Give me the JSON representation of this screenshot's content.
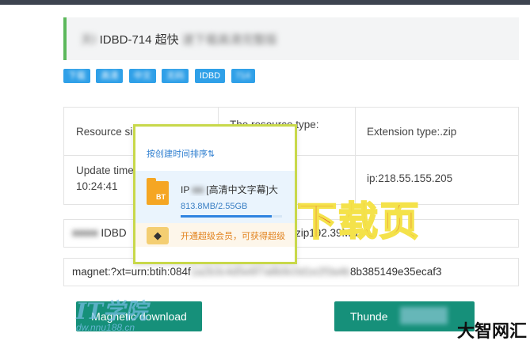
{
  "title": {
    "prefix_blurred": "天Ⅰ",
    "main": "IDBD-714 超快",
    "suffix_blurred": "速下载高清完整版"
  },
  "tags": [
    "下载",
    "高清",
    "中文",
    "无码",
    "IDBD",
    "714"
  ],
  "info": {
    "resource_size_label": "Resource si",
    "resource_type_label": "The resource type:",
    "extension_label": "Extension type:.zip",
    "update_time_label": "Update time",
    "update_time_value": "10:24:41",
    "ip_label": "ip:218.55.155.205"
  },
  "file_row_text": "IDBD",
  "ip_row_text": "zip192.39MB",
  "magnet": {
    "prefix": "magnet:?xt=urn:btih:084f",
    "blurred": "1a2b3c4d5e6f7a8b9c0d1e2f3a4b",
    "suffix": "8b385149e35ecaf3"
  },
  "buttons": {
    "magnetic_download": "Magnetic download",
    "thunder_download": "Thunde"
  },
  "overlay_label": "下载页",
  "popup": {
    "sort_label": "按创建时间排序⇅",
    "file_icon_text": "BT",
    "file_name_prefix": "IP",
    "file_name_suffix": "[高清中文字幕]大",
    "file_size": "813.8MB/2.55GB",
    "progress": 0.9,
    "vip_text": "开通超级会员，可获得超级",
    "vip_icon": "diamond-icon"
  },
  "watermark": {
    "logo": "IT学院",
    "url": "dw.nnu188.cn"
  },
  "brand": "大智网汇",
  "colors": {
    "accent_green": "#5cb85c",
    "tag_blue": "#2fa0e8",
    "button_teal": "#16907a",
    "overlay_red": "#d93124",
    "popup_border": "#c8d84a"
  }
}
